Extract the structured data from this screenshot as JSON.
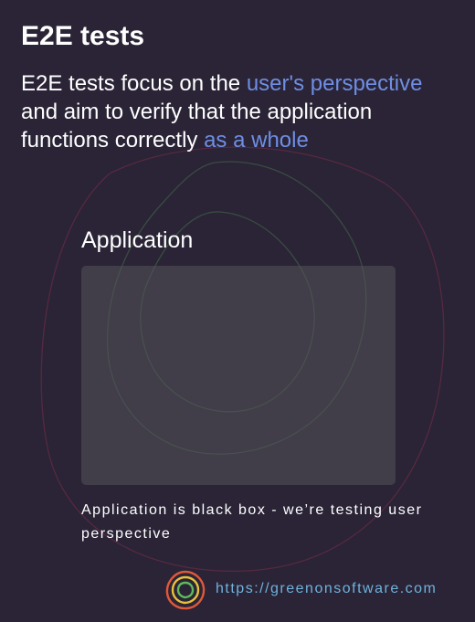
{
  "title": "E2E tests",
  "intro": {
    "part1": "E2E tests focus on the ",
    "highlight1": "user's perspective",
    "part2": " and aim to verify that the application functions correctly ",
    "highlight2": "as a whole"
  },
  "diagram": {
    "label": "Application",
    "caption": "Application is black box - we’re testing user perspective"
  },
  "footer": {
    "url": "https://greenonsoftware.com"
  },
  "colors": {
    "background": "#2a2436",
    "highlight": "#6f8ee3",
    "url": "#6fb2dd",
    "logo_ring_outer": "#e0583a",
    "logo_ring_middle": "#e8c13a",
    "logo_ring_inner": "#5dbb5a"
  },
  "icons": {
    "logo": "greenonsoftware-logo-icon"
  }
}
